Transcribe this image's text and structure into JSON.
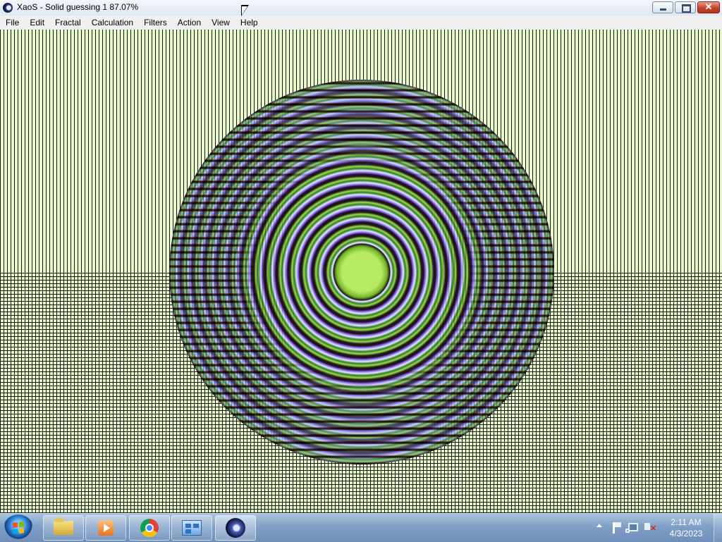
{
  "window": {
    "title": "XaoS - Solid guessing 1 87.07%",
    "icon": "xaos-app-icon",
    "controls": [
      "minimize-button",
      "maximize-button",
      "close-button"
    ]
  },
  "menu": {
    "items": [
      "File",
      "Edit",
      "Fractal",
      "Calculation",
      "Filters",
      "Action",
      "View",
      "Help"
    ]
  },
  "canvas": {
    "content": "fractal render",
    "colors": {
      "background": "#e9f8c9",
      "grid": "#141a0e",
      "center": "#9ddc4b",
      "ring_purple": "#7b5cf0"
    }
  },
  "taskbar": {
    "start_icon": "windows-start-icon",
    "apps": [
      {
        "name": "explorer",
        "icon": "folder-icon"
      },
      {
        "name": "media-player",
        "icon": "media-player-icon"
      },
      {
        "name": "chrome",
        "icon": "chrome-icon"
      },
      {
        "name": "control-panel",
        "icon": "control-panel-icon"
      },
      {
        "name": "xaos",
        "icon": "xaos-icon",
        "active": true
      }
    ],
    "tray_icons": [
      "show-hidden-icons-arrow",
      "action-center-flag-icon",
      "network-icon",
      "volume-muted-icon"
    ],
    "clock": {
      "time": "2:11 AM",
      "date": "4/3/2023"
    }
  }
}
